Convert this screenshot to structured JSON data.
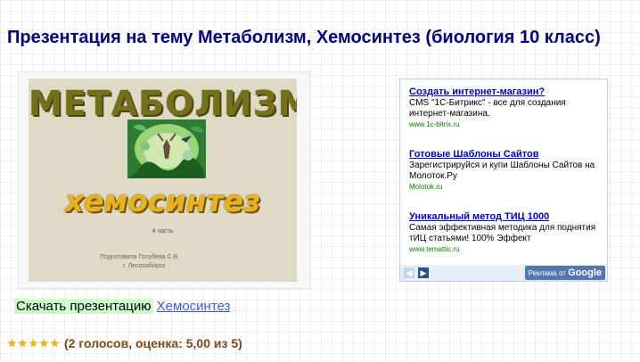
{
  "page": {
    "title": "Презентация на тему Метаболизм, Хемосинтез (биология 10 класс)"
  },
  "slide": {
    "heading": "МЕТАБОЛИЗМ",
    "subheading": "хемосинтез",
    "part": "4 часть",
    "author_line1": "Подготовила  Голубева С.В.",
    "author_line2": "г. Лесосибирск"
  },
  "ads": {
    "items": [
      {
        "title": "Создать интернет-магазин?",
        "text": "CMS \"1С-Битрикс\" - все для создания интернет-магазина.",
        "url": "www.1c-bitrix.ru"
      },
      {
        "title": "Готовые Шаблоны Сайтов",
        "text": "Зарегистрируйся и купи Шаблоны Сайтов на Молоток.Ру",
        "url": "Molotok.ru"
      },
      {
        "title": "Уникальный метод ТИЦ 1000",
        "text": "Самая эффективная методика для поднятия тИЦ статьями! 100% Эффект",
        "url": "www.temattic.ru"
      }
    ],
    "prev_icon": "chevron-left-icon",
    "next_icon": "chevron-right-icon",
    "label_prefix": "Реклама от",
    "label_brand": "Google"
  },
  "download": {
    "label": "Скачать презентацию",
    "link": "Хемосинтез"
  },
  "rating": {
    "stars_filled": 5,
    "stars_total": 5,
    "text": "(2 голосов, оценка: 5,00 из 5)"
  },
  "colors": {
    "title": "#000080",
    "link": "#3b5bdb",
    "download_highlight": "#ccffcc",
    "star": "#f4b400",
    "rating_text": "#7a4a1a"
  }
}
